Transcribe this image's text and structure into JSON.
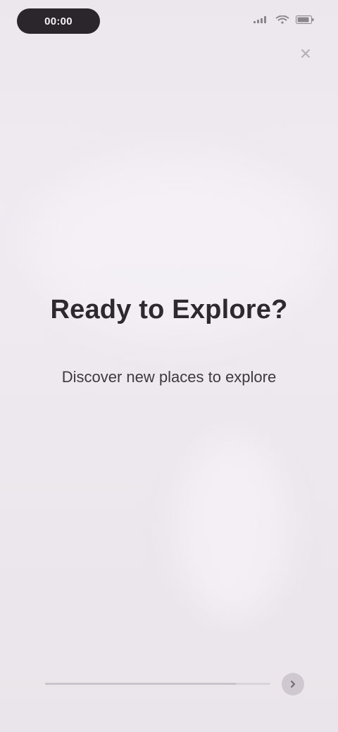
{
  "status_bar": {
    "time": "00:00",
    "icons": [
      "signal-icon",
      "wifi-icon",
      "battery-icon"
    ]
  },
  "header": {
    "close_icon": "close-icon"
  },
  "main": {
    "title": "Ready to Explore?",
    "subtitle": "Discover new places to explore"
  },
  "footer": {
    "progress": 0.85,
    "next_icon": "chevron-right-icon"
  },
  "colors": {
    "background": "#ece8ee",
    "title": "#2d2a2f",
    "accent": "#cfc8d0"
  }
}
